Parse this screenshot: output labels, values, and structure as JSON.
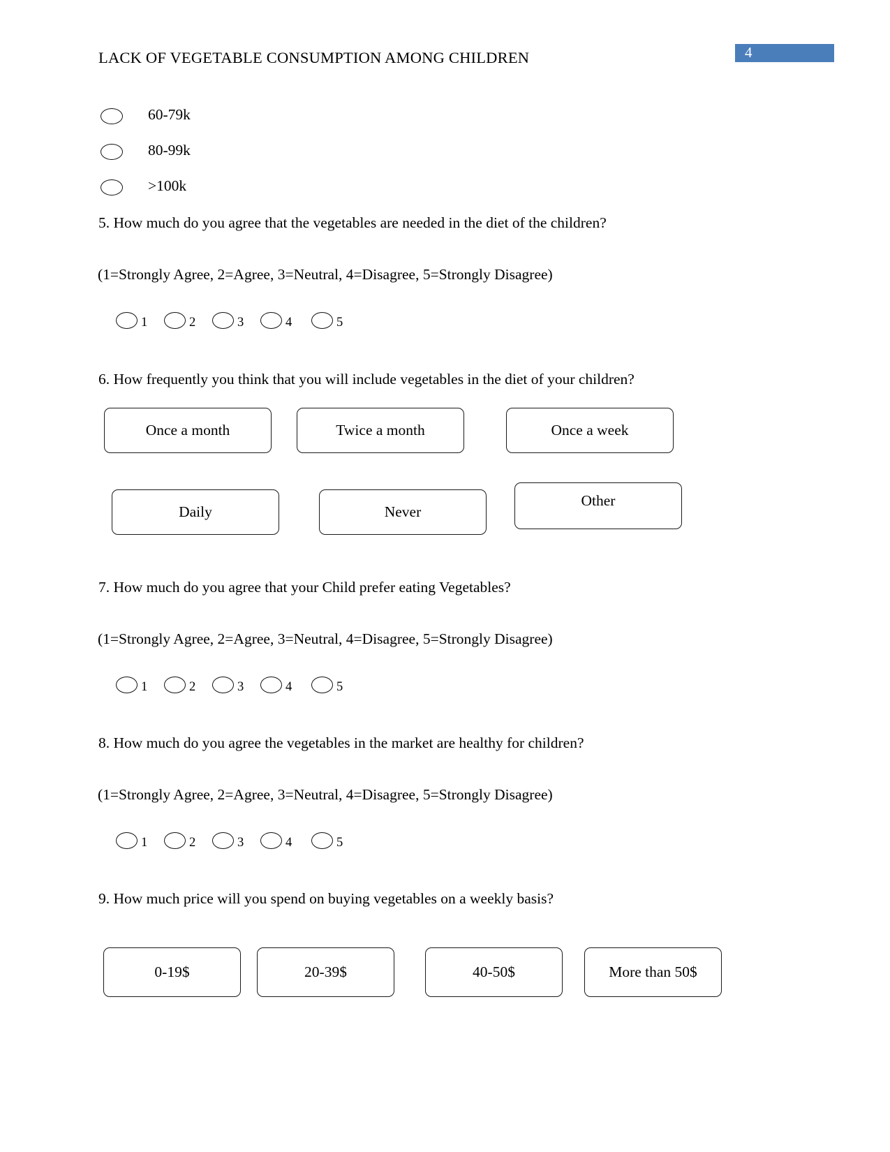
{
  "header": {
    "title": "LACK OF VEGETABLE CONSUMPTION AMONG CHILDREN",
    "page_number": "4",
    "badge_color": "#4a7ebb",
    "badge_text_color": "#ffffff"
  },
  "income_options": [
    {
      "label": "60-79k",
      "icon": "radio-ellipse-icon"
    },
    {
      "label": "80-99k",
      "icon": "radio-ellipse-icon"
    },
    {
      "label": ">100k",
      "icon": "radio-ellipse-icon"
    }
  ],
  "scale_note": "(1=Strongly Agree, 2=Agree, 3=Neutral, 4=Disagree, 5=Strongly Disagree)",
  "likert_values": [
    "1",
    "2",
    "3",
    "4",
    "5"
  ],
  "questions": [
    {
      "id": "q5",
      "text": "5. How much do you agree that the vegetables are needed in the diet of the children?",
      "note": "(1=Strongly Agree, 2=Agree, 3=Neutral, 4=Disagree, 5=Strongly Disagree)",
      "type": "likert"
    },
    {
      "id": "q6",
      "text": "6. How frequently you think that you will include vegetables in the diet of your children?",
      "type": "boxes",
      "options": [
        "Once a month",
        "Twice a month",
        "Once a week",
        "Daily",
        "Never",
        "Other"
      ]
    },
    {
      "id": "q7",
      "text": "7. How much do you agree that your Child prefer eating Vegetables?",
      "note": "(1=Strongly Agree, 2=Agree, 3=Neutral, 4=Disagree, 5=Strongly Disagree)",
      "type": "likert"
    },
    {
      "id": "q8",
      "text": "8. How much do you agree the vegetables in the market are healthy for children?",
      "note": "(1=Strongly Agree, 2=Agree, 3=Neutral, 4=Disagree, 5=Strongly Disagree)",
      "type": "likert"
    },
    {
      "id": "q9",
      "text": "9. How much price will you spend on buying vegetables on a weekly basis?",
      "type": "boxes",
      "options": [
        "0-19$",
        "20-39$",
        "40-50$",
        "More than 50$"
      ]
    }
  ]
}
